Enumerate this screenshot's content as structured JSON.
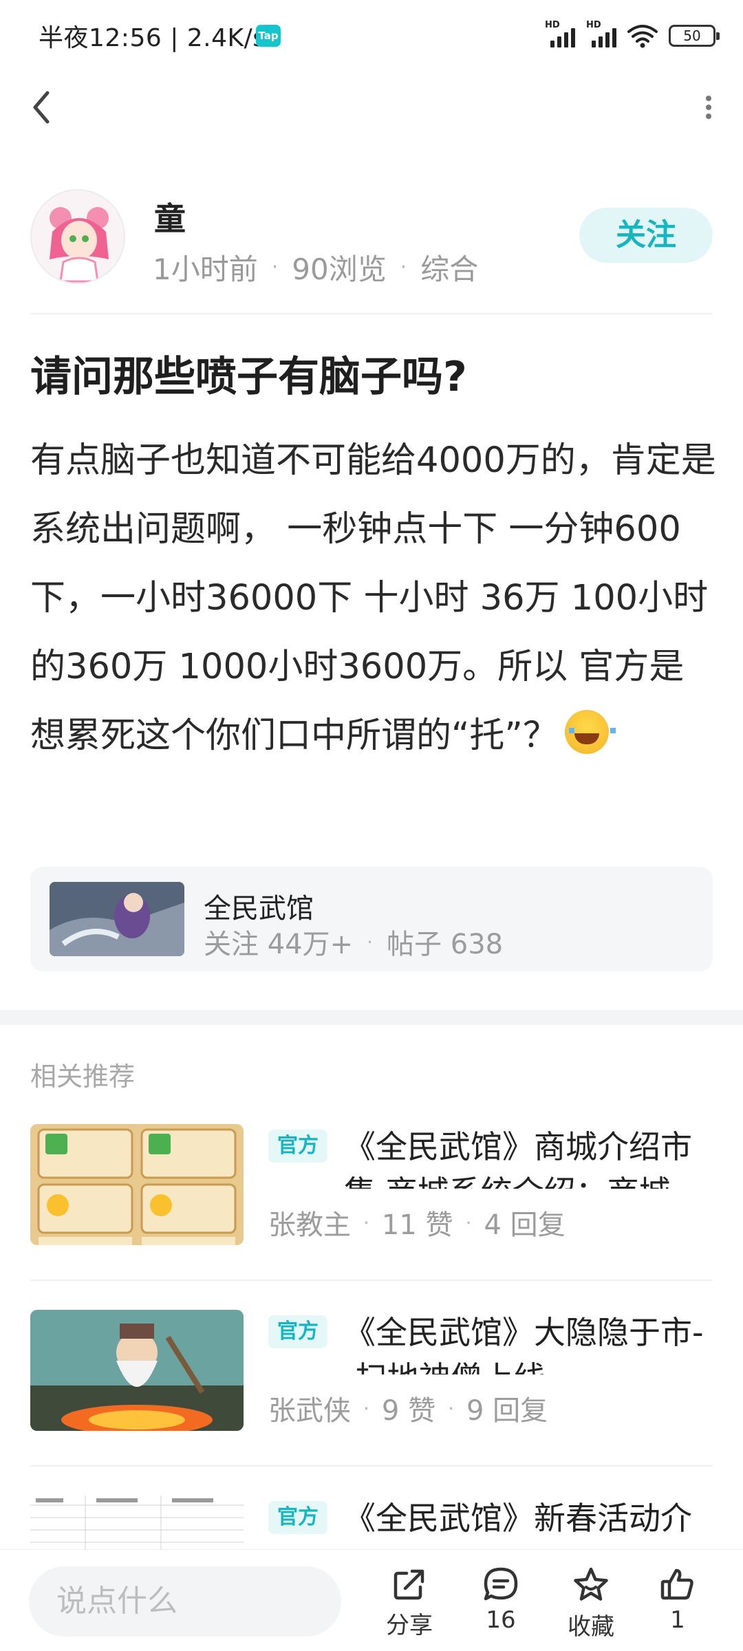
{
  "status_bar": {
    "text": "半夜12:56 | 2.4K/s",
    "tap_badge": "Tap",
    "signal_label": "HD",
    "battery": "50"
  },
  "author": {
    "name": "童",
    "time": "1小时前",
    "views": "90浏览",
    "category": "综合",
    "follow_label": "关注"
  },
  "post": {
    "title": "请问那些喷子有脑子吗?",
    "body": "有点脑子也知道不可能给4000万的，肯定是系统出问题啊， 一秒钟点十下 一分钟600下，一小时36000下 十小时 36万 100小时 的360万 1000小时3600万。所以 官方是想累死这个你们口中所谓的“托”？"
  },
  "game_card": {
    "name": "全民武馆",
    "followers": "关注 44万+",
    "posts": "帖子 638"
  },
  "related": {
    "section_title": "相关推荐",
    "items": [
      {
        "tag": "官方",
        "title": "《全民武馆》商城介绍市集 商城系统介绍：商城",
        "author": "张教主",
        "likes": "11 赞",
        "replies": "4 回复"
      },
      {
        "tag": "官方",
        "title": "《全民武馆》大隐隐于市--扫地神僧上线",
        "author": "张武侠",
        "likes": "9 赞",
        "replies": "9 回复"
      },
      {
        "tag": "官方",
        "title": "《全民武馆》新春活动介",
        "author": "",
        "likes": "",
        "replies": ""
      }
    ]
  },
  "bottom_bar": {
    "placeholder": "说点什么",
    "share_label": "分享",
    "comment_count": "16",
    "favorite_label": "收藏",
    "like_count": "1"
  },
  "colors": {
    "accent": "#15b6bf",
    "accent_bg": "#e3f6f7",
    "muted_text": "#9c9c9c"
  }
}
